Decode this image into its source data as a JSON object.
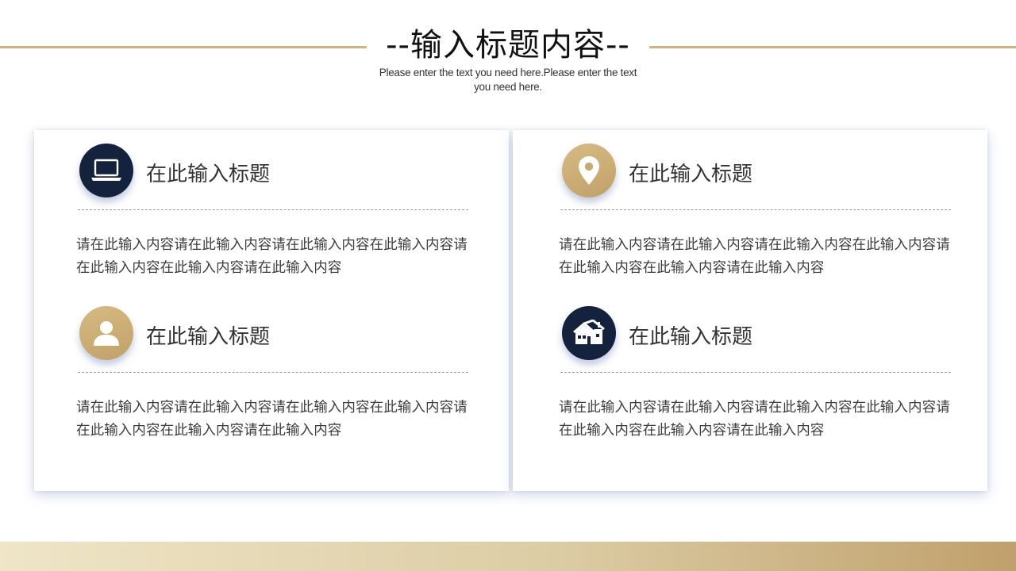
{
  "header": {
    "title": "--输入标题内容--",
    "subtitle": "Please enter the text you need here.Please enter the text you need here."
  },
  "colors": {
    "navy": "#14223d",
    "gold": "#c8aa73",
    "rule": "#d2b483",
    "band_start": "#efe5c7",
    "band_end": "#c0a06c"
  },
  "cards": [
    {
      "items": [
        {
          "icon": "laptop-icon",
          "title": "在此输入标题",
          "text": "请在此输入内容请在此输入内容请在此输入内容在此输入内容请在此输入内容在此输入内容请在此输入内容"
        },
        {
          "icon": "user-icon",
          "title": "在此输入标题",
          "text": "请在此输入内容请在此输入内容请在此输入内容在此输入内容请在此输入内容在此输入内容请在此输入内容"
        }
      ]
    },
    {
      "items": [
        {
          "icon": "location-pin-icon",
          "title": "在此输入标题",
          "text": "请在此输入内容请在此输入内容请在此输入内容在此输入内容请在此输入内容在此输入内容请在此输入内容"
        },
        {
          "icon": "house-icon",
          "title": "在此输入标题",
          "text": "请在此输入内容请在此输入内容请在此输入内容在此输入内容请在此输入内容在此输入内容请在此输入内容"
        }
      ]
    }
  ]
}
